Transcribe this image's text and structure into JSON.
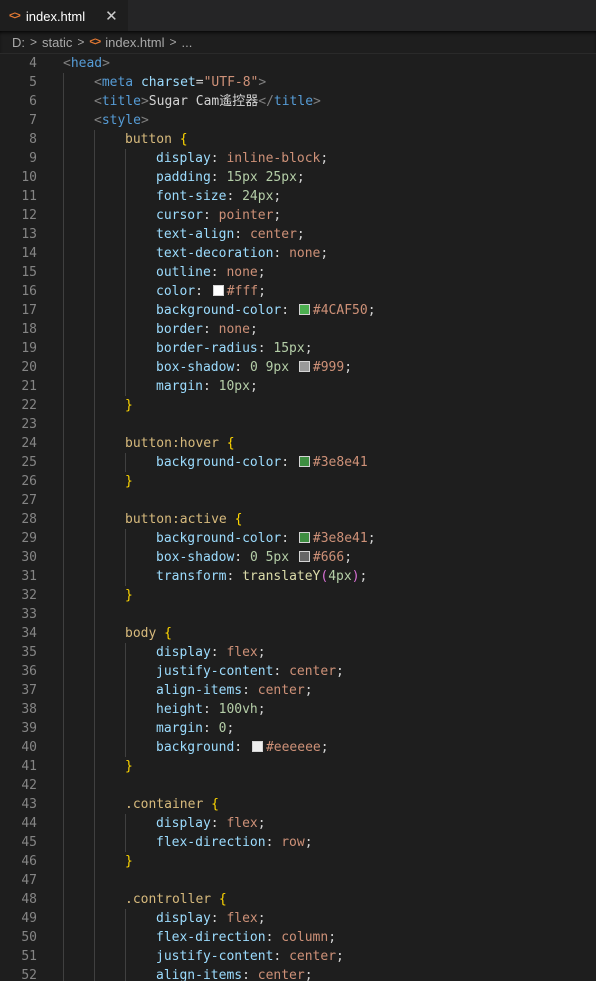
{
  "tab": {
    "label": "index.html",
    "icon": "html-file-icon",
    "close": "✕"
  },
  "breadcrumb": {
    "drive": "D:",
    "folder": "static",
    "file": "index.html",
    "more": "..."
  },
  "colors": {
    "green": "#4CAF50",
    "white": "#fff",
    "gray999": "#999",
    "hover": "#3e8e41",
    "gray666": "#666",
    "bg": "#eeeeee"
  },
  "lines": [
    {
      "n": "4",
      "i": 0,
      "t": [
        [
          "punc",
          "<"
        ],
        [
          "tag",
          "head"
        ],
        [
          "punc",
          ">"
        ]
      ]
    },
    {
      "n": "5",
      "i": 1,
      "t": [
        [
          "punc",
          "<"
        ],
        [
          "tag",
          "meta"
        ],
        [
          "text",
          " "
        ],
        [
          "attr",
          "charset"
        ],
        [
          "text",
          "="
        ],
        [
          "str",
          "\"UTF-8\""
        ],
        [
          "punc",
          ">"
        ]
      ]
    },
    {
      "n": "6",
      "i": 1,
      "t": [
        [
          "punc",
          "<"
        ],
        [
          "tag",
          "title"
        ],
        [
          "punc",
          ">"
        ],
        [
          "text",
          "Sugar Cam遙控器"
        ],
        [
          "punc",
          "</"
        ],
        [
          "tag",
          "title"
        ],
        [
          "punc",
          ">"
        ]
      ]
    },
    {
      "n": "7",
      "i": 1,
      "t": [
        [
          "punc",
          "<"
        ],
        [
          "tag",
          "style"
        ],
        [
          "punc",
          ">"
        ]
      ]
    },
    {
      "n": "8",
      "i": 2,
      "t": [
        [
          "sel",
          "button"
        ],
        [
          "text",
          " "
        ],
        [
          "brace",
          "{"
        ]
      ]
    },
    {
      "n": "9",
      "i": 3,
      "t": [
        [
          "prop",
          "display"
        ],
        [
          "text",
          ": "
        ],
        [
          "val",
          "inline-block"
        ],
        [
          "text",
          ";"
        ]
      ]
    },
    {
      "n": "10",
      "i": 3,
      "t": [
        [
          "prop",
          "padding"
        ],
        [
          "text",
          ": "
        ],
        [
          "num",
          "15px 25px"
        ],
        [
          "text",
          ";"
        ]
      ]
    },
    {
      "n": "11",
      "i": 3,
      "t": [
        [
          "prop",
          "font-size"
        ],
        [
          "text",
          ": "
        ],
        [
          "num",
          "24px"
        ],
        [
          "text",
          ";"
        ]
      ]
    },
    {
      "n": "12",
      "i": 3,
      "t": [
        [
          "prop",
          "cursor"
        ],
        [
          "text",
          ": "
        ],
        [
          "val",
          "pointer"
        ],
        [
          "text",
          ";"
        ]
      ]
    },
    {
      "n": "13",
      "i": 3,
      "t": [
        [
          "prop",
          "text-align"
        ],
        [
          "text",
          ": "
        ],
        [
          "val",
          "center"
        ],
        [
          "text",
          ";"
        ]
      ]
    },
    {
      "n": "14",
      "i": 3,
      "t": [
        [
          "prop",
          "text-decoration"
        ],
        [
          "text",
          ": "
        ],
        [
          "val",
          "none"
        ],
        [
          "text",
          ";"
        ]
      ]
    },
    {
      "n": "15",
      "i": 3,
      "t": [
        [
          "prop",
          "outline"
        ],
        [
          "text",
          ": "
        ],
        [
          "val",
          "none"
        ],
        [
          "text",
          ";"
        ]
      ]
    },
    {
      "n": "16",
      "i": 3,
      "t": [
        [
          "prop",
          "color"
        ],
        [
          "text",
          ": "
        ],
        [
          "swatch",
          "#fff"
        ],
        [
          "val",
          "#fff"
        ],
        [
          "text",
          ";"
        ]
      ]
    },
    {
      "n": "17",
      "i": 3,
      "t": [
        [
          "prop",
          "background-color"
        ],
        [
          "text",
          ": "
        ],
        [
          "swatch",
          "#4CAF50"
        ],
        [
          "val",
          "#4CAF50"
        ],
        [
          "text",
          ";"
        ]
      ]
    },
    {
      "n": "18",
      "i": 3,
      "t": [
        [
          "prop",
          "border"
        ],
        [
          "text",
          ": "
        ],
        [
          "val",
          "none"
        ],
        [
          "text",
          ";"
        ]
      ]
    },
    {
      "n": "19",
      "i": 3,
      "t": [
        [
          "prop",
          "border-radius"
        ],
        [
          "text",
          ": "
        ],
        [
          "num",
          "15px"
        ],
        [
          "text",
          ";"
        ]
      ]
    },
    {
      "n": "20",
      "i": 3,
      "t": [
        [
          "prop",
          "box-shadow"
        ],
        [
          "text",
          ": "
        ],
        [
          "num",
          "0 9px"
        ],
        [
          "text",
          " "
        ],
        [
          "swatch",
          "#999"
        ],
        [
          "val",
          "#999"
        ],
        [
          "text",
          ";"
        ]
      ]
    },
    {
      "n": "21",
      "i": 3,
      "t": [
        [
          "prop",
          "margin"
        ],
        [
          "text",
          ": "
        ],
        [
          "num",
          "10px"
        ],
        [
          "text",
          ";"
        ]
      ]
    },
    {
      "n": "22",
      "i": 2,
      "t": [
        [
          "brace",
          "}"
        ]
      ]
    },
    {
      "n": "23",
      "i": 2,
      "t": []
    },
    {
      "n": "24",
      "i": 2,
      "t": [
        [
          "sel",
          "button:hover"
        ],
        [
          "text",
          " "
        ],
        [
          "brace",
          "{"
        ]
      ]
    },
    {
      "n": "25",
      "i": 3,
      "t": [
        [
          "prop",
          "background-color"
        ],
        [
          "text",
          ": "
        ],
        [
          "swatch",
          "#3e8e41"
        ],
        [
          "val",
          "#3e8e41"
        ]
      ]
    },
    {
      "n": "26",
      "i": 2,
      "t": [
        [
          "brace",
          "}"
        ]
      ]
    },
    {
      "n": "27",
      "i": 2,
      "t": []
    },
    {
      "n": "28",
      "i": 2,
      "t": [
        [
          "sel",
          "button:active"
        ],
        [
          "text",
          " "
        ],
        [
          "brace",
          "{"
        ]
      ]
    },
    {
      "n": "29",
      "i": 3,
      "t": [
        [
          "prop",
          "background-color"
        ],
        [
          "text",
          ": "
        ],
        [
          "swatch",
          "#3e8e41"
        ],
        [
          "val",
          "#3e8e41"
        ],
        [
          "text",
          ";"
        ]
      ]
    },
    {
      "n": "30",
      "i": 3,
      "t": [
        [
          "prop",
          "box-shadow"
        ],
        [
          "text",
          ": "
        ],
        [
          "num",
          "0 5px"
        ],
        [
          "text",
          " "
        ],
        [
          "swatch",
          "#666"
        ],
        [
          "val",
          "#666"
        ],
        [
          "text",
          ";"
        ]
      ]
    },
    {
      "n": "31",
      "i": 3,
      "t": [
        [
          "prop",
          "transform"
        ],
        [
          "text",
          ": "
        ],
        [
          "fn",
          "translateY"
        ],
        [
          "brace2",
          "("
        ],
        [
          "num",
          "4px"
        ],
        [
          "brace2",
          ")"
        ],
        [
          "text",
          ";"
        ]
      ]
    },
    {
      "n": "32",
      "i": 2,
      "t": [
        [
          "brace",
          "}"
        ]
      ]
    },
    {
      "n": "33",
      "i": 2,
      "t": []
    },
    {
      "n": "34",
      "i": 2,
      "t": [
        [
          "sel",
          "body"
        ],
        [
          "text",
          " "
        ],
        [
          "brace",
          "{"
        ]
      ]
    },
    {
      "n": "35",
      "i": 3,
      "t": [
        [
          "prop",
          "display"
        ],
        [
          "text",
          ": "
        ],
        [
          "val",
          "flex"
        ],
        [
          "text",
          ";"
        ]
      ]
    },
    {
      "n": "36",
      "i": 3,
      "t": [
        [
          "prop",
          "justify-content"
        ],
        [
          "text",
          ": "
        ],
        [
          "val",
          "center"
        ],
        [
          "text",
          ";"
        ]
      ]
    },
    {
      "n": "37",
      "i": 3,
      "t": [
        [
          "prop",
          "align-items"
        ],
        [
          "text",
          ": "
        ],
        [
          "val",
          "center"
        ],
        [
          "text",
          ";"
        ]
      ]
    },
    {
      "n": "38",
      "i": 3,
      "t": [
        [
          "prop",
          "height"
        ],
        [
          "text",
          ": "
        ],
        [
          "num",
          "100vh"
        ],
        [
          "text",
          ";"
        ]
      ]
    },
    {
      "n": "39",
      "i": 3,
      "t": [
        [
          "prop",
          "margin"
        ],
        [
          "text",
          ": "
        ],
        [
          "num",
          "0"
        ],
        [
          "text",
          ";"
        ]
      ]
    },
    {
      "n": "40",
      "i": 3,
      "t": [
        [
          "prop",
          "background"
        ],
        [
          "text",
          ": "
        ],
        [
          "swatch",
          "#eeeeee"
        ],
        [
          "val",
          "#eeeeee"
        ],
        [
          "text",
          ";"
        ]
      ]
    },
    {
      "n": "41",
      "i": 2,
      "t": [
        [
          "brace",
          "}"
        ]
      ]
    },
    {
      "n": "42",
      "i": 2,
      "t": []
    },
    {
      "n": "43",
      "i": 2,
      "t": [
        [
          "sel",
          ".container"
        ],
        [
          "text",
          " "
        ],
        [
          "brace",
          "{"
        ]
      ]
    },
    {
      "n": "44",
      "i": 3,
      "t": [
        [
          "prop",
          "display"
        ],
        [
          "text",
          ": "
        ],
        [
          "val",
          "flex"
        ],
        [
          "text",
          ";"
        ]
      ]
    },
    {
      "n": "45",
      "i": 3,
      "t": [
        [
          "prop",
          "flex-direction"
        ],
        [
          "text",
          ": "
        ],
        [
          "val",
          "row"
        ],
        [
          "text",
          ";"
        ]
      ]
    },
    {
      "n": "46",
      "i": 2,
      "t": [
        [
          "brace",
          "}"
        ]
      ]
    },
    {
      "n": "47",
      "i": 2,
      "t": []
    },
    {
      "n": "48",
      "i": 2,
      "t": [
        [
          "sel",
          ".controller"
        ],
        [
          "text",
          " "
        ],
        [
          "brace",
          "{"
        ]
      ]
    },
    {
      "n": "49",
      "i": 3,
      "t": [
        [
          "prop",
          "display"
        ],
        [
          "text",
          ": "
        ],
        [
          "val",
          "flex"
        ],
        [
          "text",
          ";"
        ]
      ]
    },
    {
      "n": "50",
      "i": 3,
      "t": [
        [
          "prop",
          "flex-direction"
        ],
        [
          "text",
          ": "
        ],
        [
          "val",
          "column"
        ],
        [
          "text",
          ";"
        ]
      ]
    },
    {
      "n": "51",
      "i": 3,
      "t": [
        [
          "prop",
          "justify-content"
        ],
        [
          "text",
          ": "
        ],
        [
          "val",
          "center"
        ],
        [
          "text",
          ";"
        ]
      ]
    },
    {
      "n": "52",
      "i": 3,
      "t": [
        [
          "prop",
          "align-items"
        ],
        [
          "text",
          ": "
        ],
        [
          "val",
          "center"
        ],
        [
          "text",
          ";"
        ]
      ]
    }
  ]
}
